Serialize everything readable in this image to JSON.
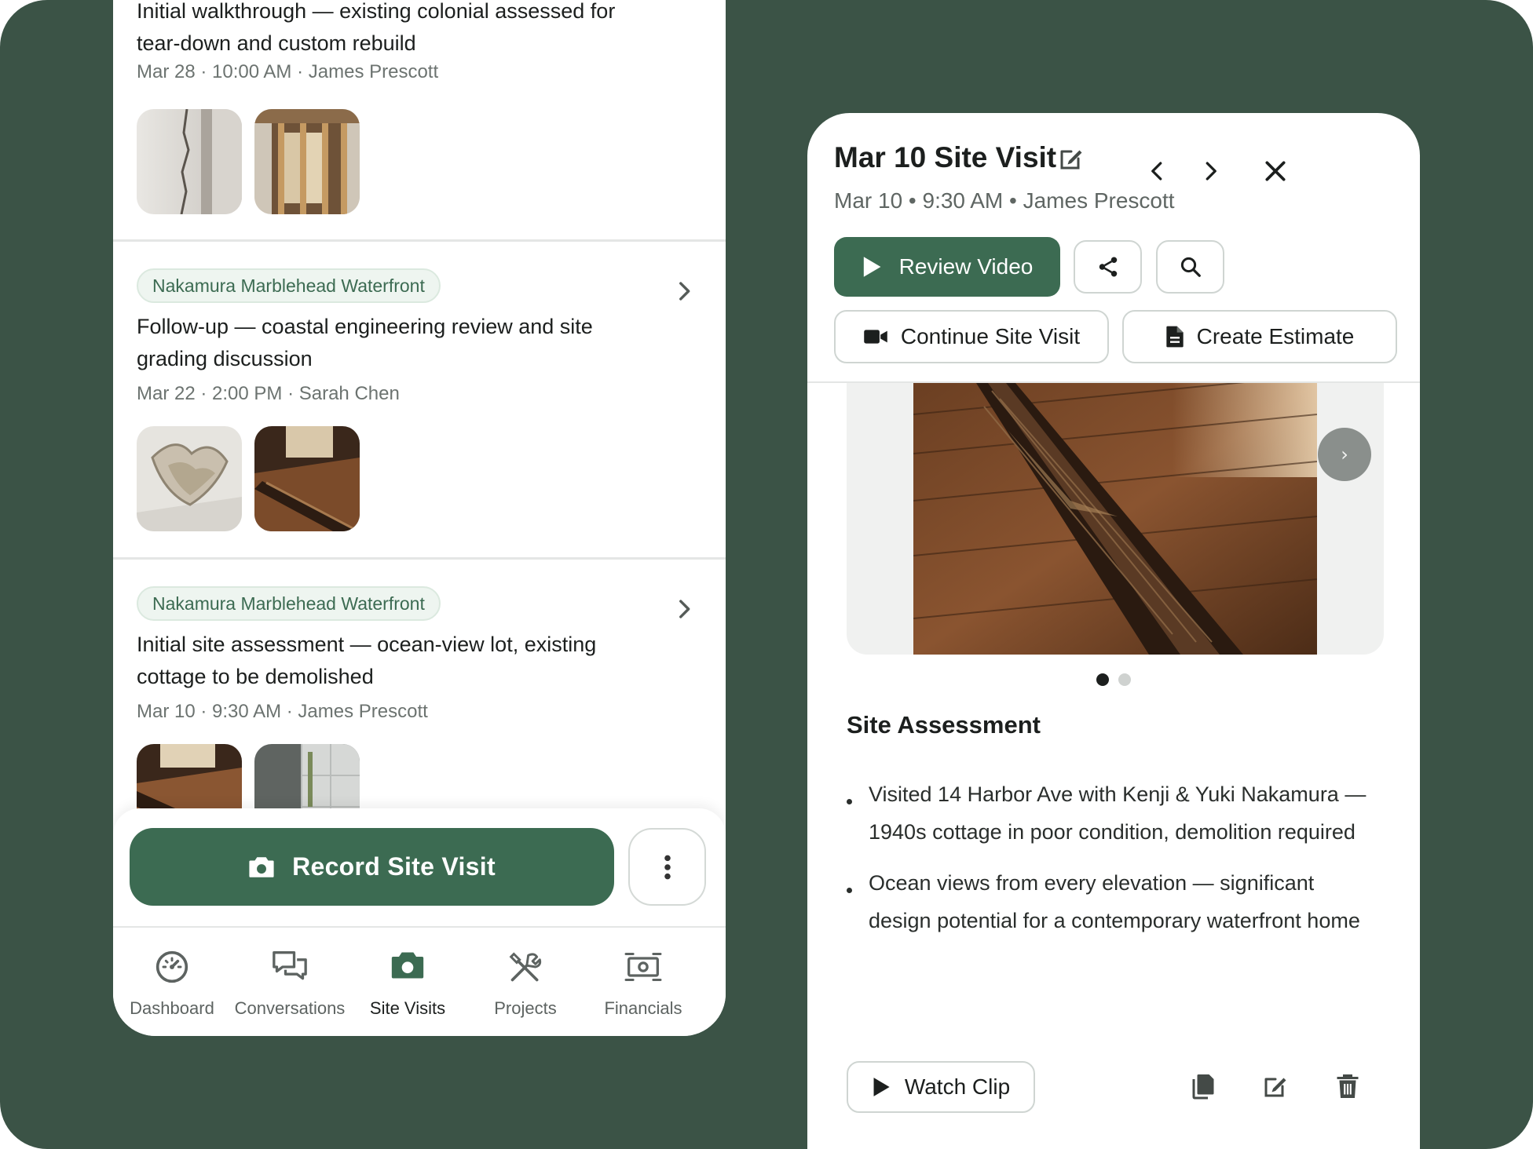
{
  "left_panel": {
    "entries": [
      {
        "tag": "",
        "title": "Initial walkthrough — existing colonial assessed for tear-down and custom rebuild",
        "meta": "Mar 28 · 10:00 AM · James Prescott"
      },
      {
        "tag": "Nakamura Marblehead Waterfront",
        "title": "Follow-up — coastal engineering review and site grading discussion",
        "meta": "Mar 22 · 2:00 PM · Sarah Chen"
      },
      {
        "tag": "Nakamura Marblehead Waterfront",
        "title": "Initial site assessment — ocean-view lot, existing cottage to be demolished",
        "meta": "Mar 10 · 9:30 AM · James Prescott"
      }
    ],
    "record_button_label": "Record Site Visit",
    "nav": {
      "dashboard": "Dashboard",
      "conversations": "Conversations",
      "site_visits": "Site Visits",
      "projects": "Projects",
      "financials": "Financials",
      "active": "Site Visits"
    }
  },
  "right_panel": {
    "title": "Mar 10 Site Visit",
    "subtitle": "Mar 10 • 9:30 AM • James Prescott",
    "review_video_label": "Review Video",
    "continue_label": "Continue Site Visit",
    "estimate_label": "Create Estimate",
    "gallery": {
      "current_slide": 1,
      "total_slides": 2,
      "next_glyph": "›"
    },
    "section_title": "Site Assessment",
    "bullets": [
      "Visited 14 Harbor Ave with Kenji & Yuki Nakamura — 1940s cottage in poor condition, demolition required",
      "Ocean views from every elevation — significant design potential for a contemporary waterfront home"
    ],
    "watch_clip_label": "Watch Clip"
  },
  "colors": {
    "background": "#3b5346",
    "accent": "#3c6b52",
    "tag_bg": "#eef5f0",
    "tag_text": "#3c6b52"
  },
  "icons": {
    "record": "camera-icon",
    "more": "more-vertical-icon",
    "edit": "edit-icon",
    "prev": "chevron-left-icon",
    "next": "chevron-right-icon",
    "close": "close-icon",
    "share": "share-icon",
    "search": "search-icon",
    "video": "video-camera-icon",
    "document": "document-icon",
    "play": "play-icon",
    "copy": "copy-icon",
    "delete": "trash-icon"
  }
}
